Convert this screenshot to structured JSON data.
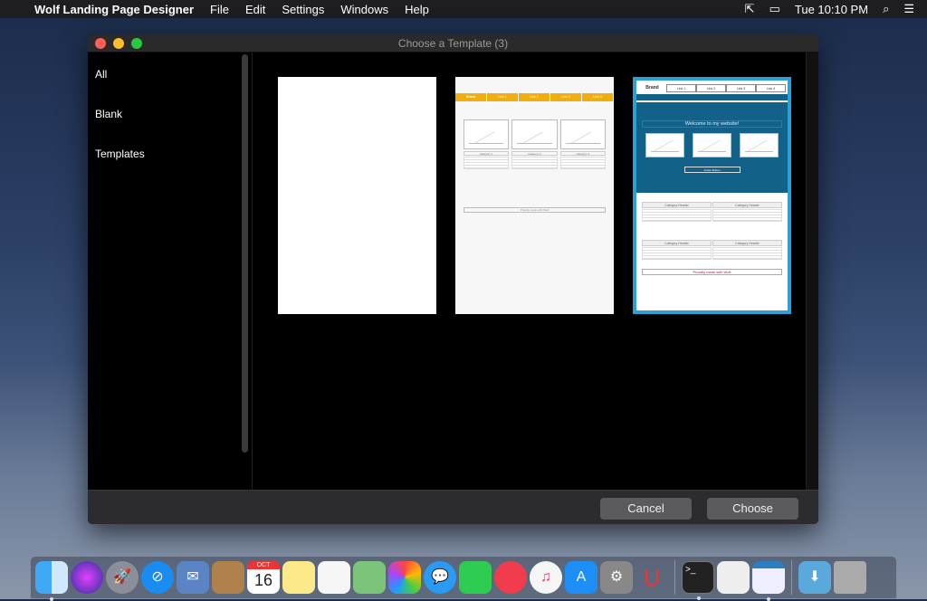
{
  "menubar": {
    "app": "Wolf Landing Page Designer",
    "menus": [
      "File",
      "Edit",
      "Settings",
      "Windows",
      "Help"
    ],
    "clock": "Tue 10:10 PM"
  },
  "window": {
    "title": "Choose a Template (3)"
  },
  "sidebar": {
    "items": [
      "All",
      "Blank",
      "Templates"
    ]
  },
  "templates": {
    "t2": {
      "brand": "Brand",
      "links": [
        "Link 1",
        "Link 2",
        "Link 3",
        "Link 4"
      ],
      "categories": [
        "Category 1",
        "Category 2",
        "Category 3"
      ],
      "footer": "Proudly made with Wolf"
    },
    "t3": {
      "brand": "Brand",
      "links": [
        "Link 1",
        "Link 2",
        "Link 3",
        "Link 4"
      ],
      "welcome": "Welcome to my website!",
      "action": "Action Button",
      "header": "Category Header",
      "footer": "Proudly made with Wolf"
    }
  },
  "footer": {
    "cancel": "Cancel",
    "choose": "Choose"
  },
  "dock": {
    "calendar_month": "OCT",
    "calendar_day": "16"
  },
  "colors": {
    "accent": "#2aa0d6",
    "orange": "#f0ad0e",
    "hero": "#136088"
  }
}
